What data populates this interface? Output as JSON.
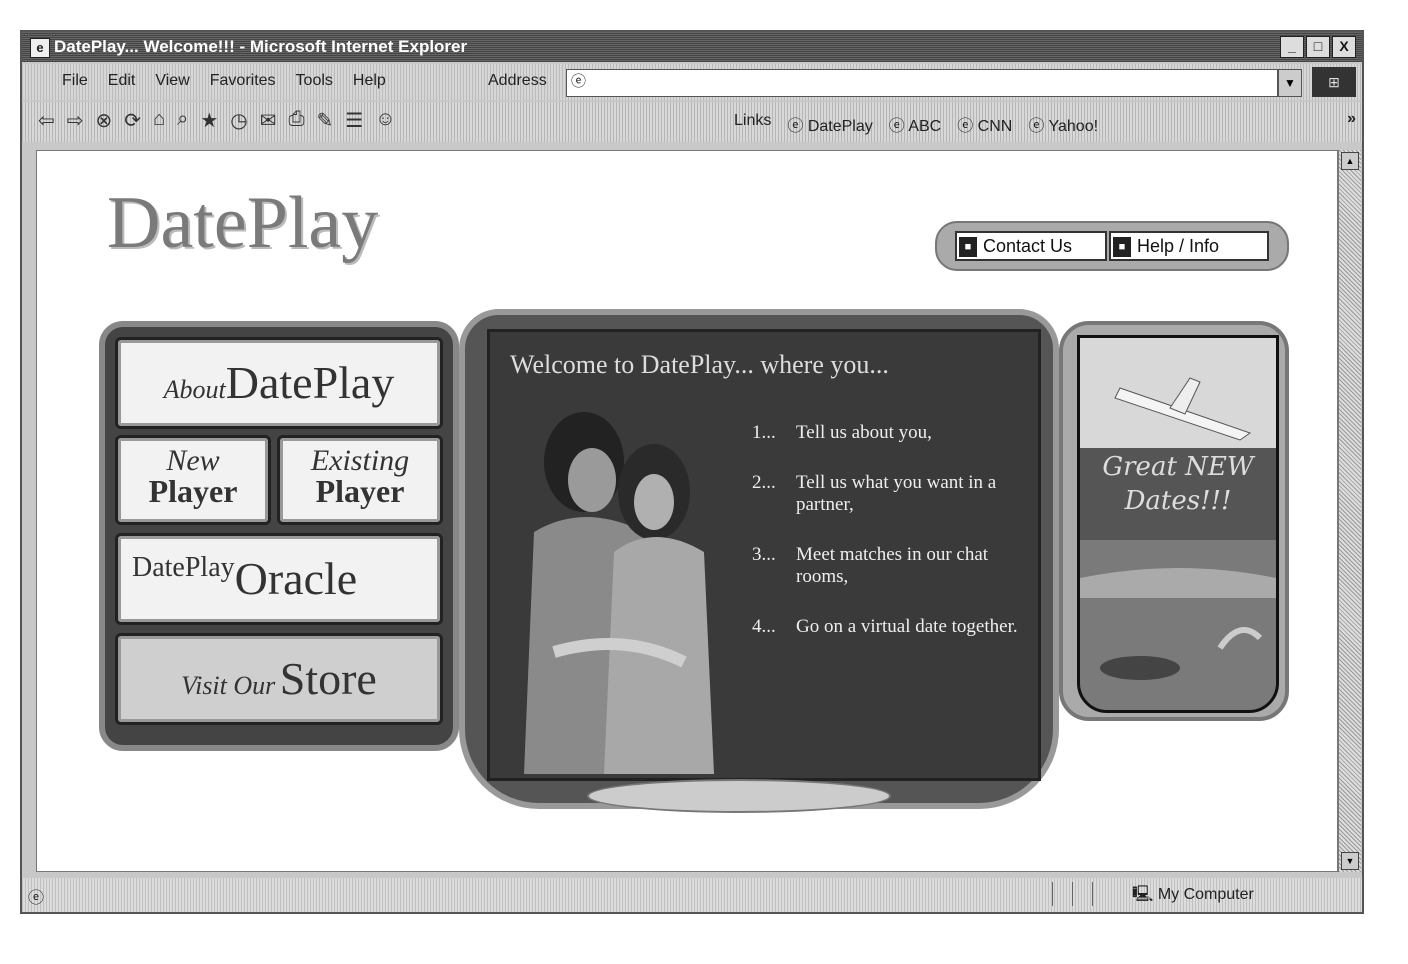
{
  "window": {
    "title": "DatePlay... Welcome!!! - Microsoft Internet Explorer",
    "app_icon": "ie-icon",
    "controls": [
      "_",
      "□",
      "X"
    ]
  },
  "menubar": {
    "items": [
      "File",
      "Edit",
      "View",
      "Favorites",
      "Tools",
      "Help"
    ],
    "address_label": "Address",
    "address_value": ""
  },
  "toolbar": {
    "links_label": "Links",
    "links": [
      "DatePlay",
      "ABC",
      "CNN",
      "Yahoo!"
    ],
    "overflow": "»"
  },
  "page": {
    "logo": "DatePlay",
    "topnav": {
      "contact": "Contact Us",
      "help": "Help / Info"
    },
    "left_buttons": {
      "about_small": "About",
      "about_big": "DatePlay",
      "new_small": "New",
      "new_big": "Player",
      "existing_small": "Existing",
      "existing_big": "Player",
      "oracle_small": "DatePlay",
      "oracle_big": "Oracle",
      "store_small": "Visit Our",
      "store_big": "Store"
    },
    "welcome": "Welcome to DatePlay... where you...",
    "steps": [
      {
        "num": "1...",
        "text": "Tell us about you,"
      },
      {
        "num": "2...",
        "text": "Tell us what you want in a partner,"
      },
      {
        "num": "3...",
        "text": "Meet matches in our chat rooms,"
      },
      {
        "num": "4...",
        "text": "Go on a virtual date together."
      }
    ],
    "promo_line1": "Great NEW",
    "promo_line2": "Dates!!!"
  },
  "statusbar": {
    "zone": "My Computer"
  }
}
